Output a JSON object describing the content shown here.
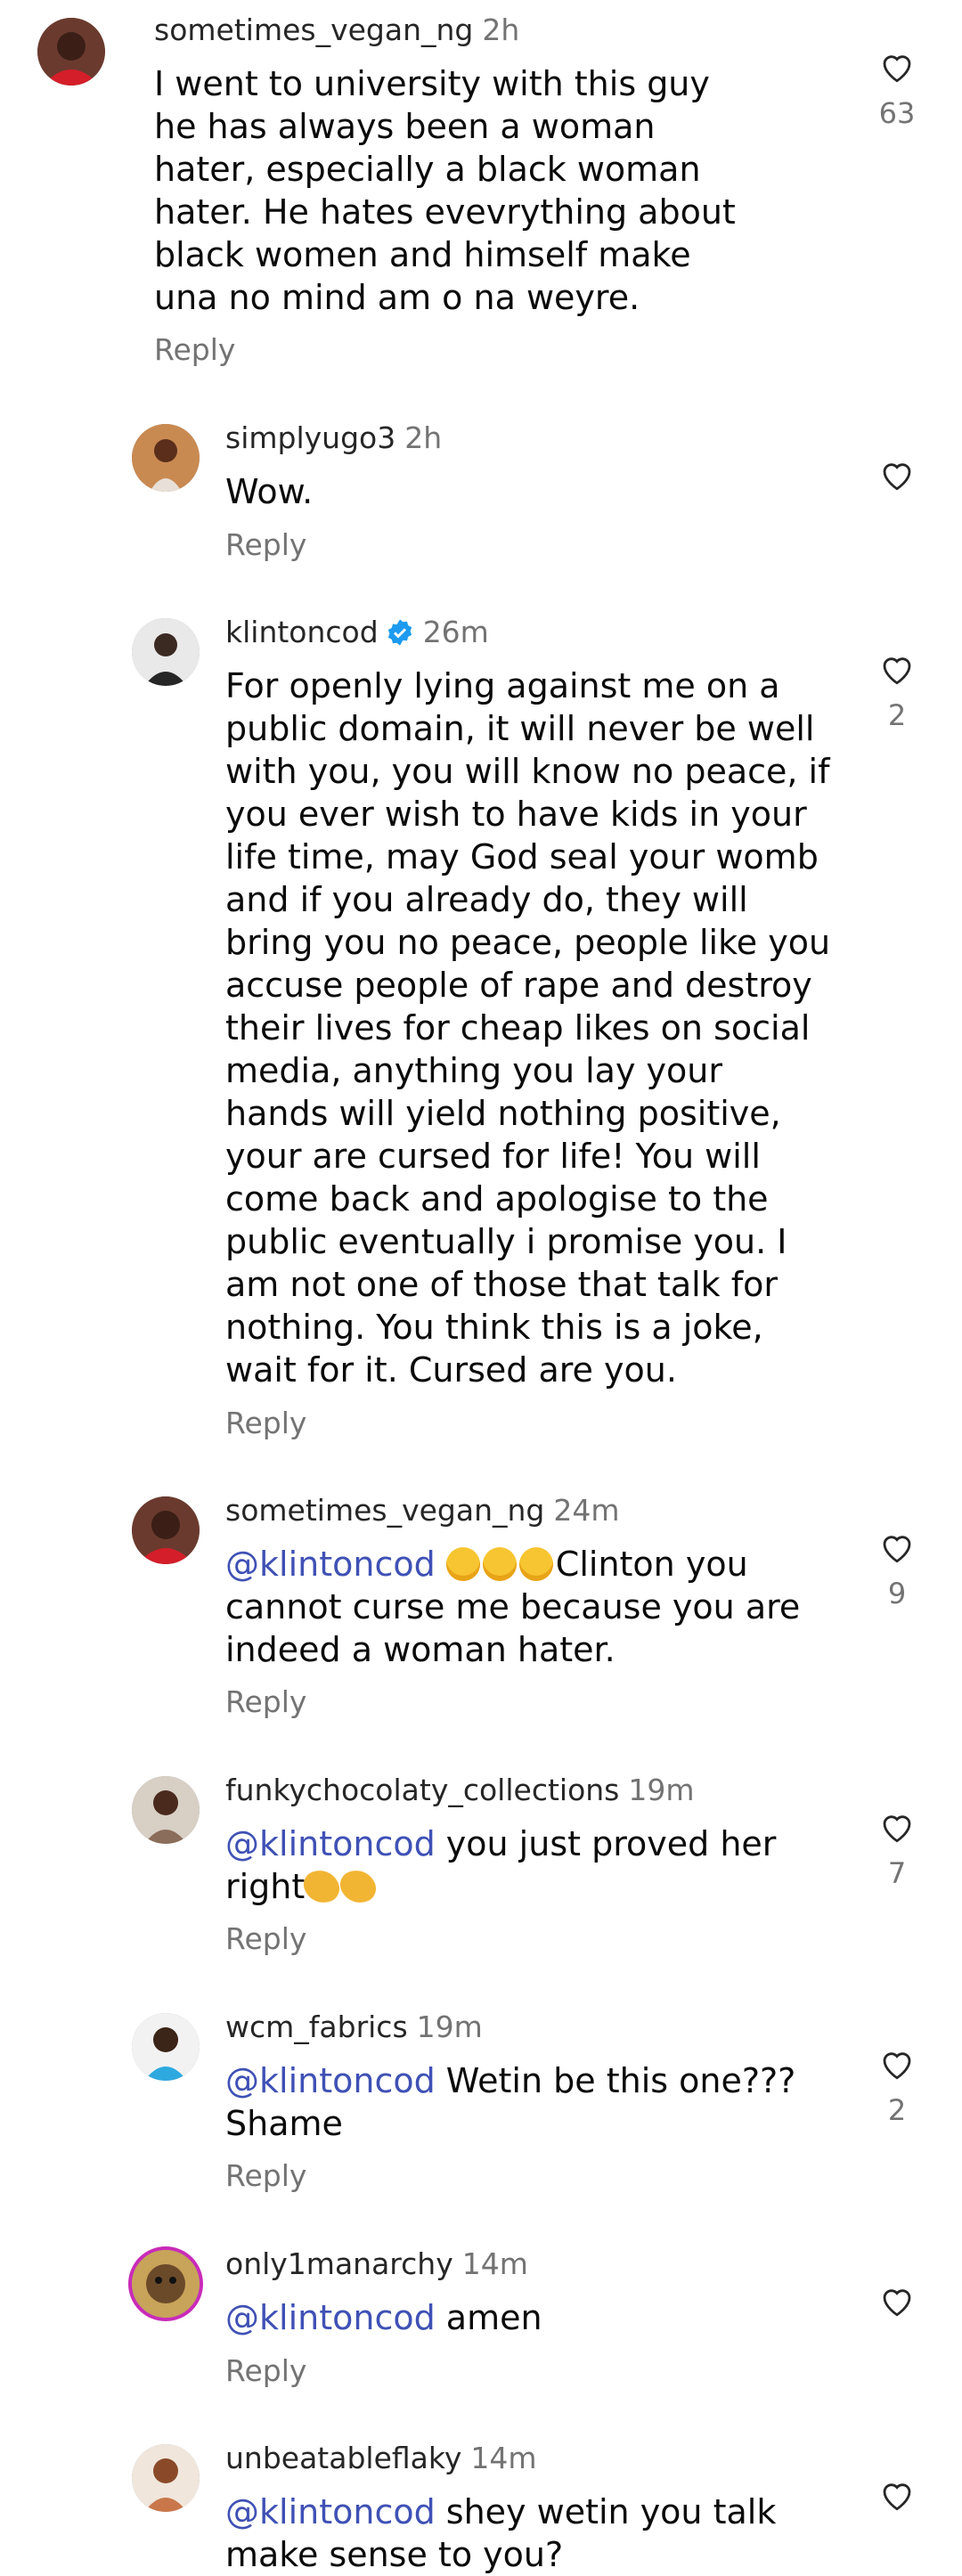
{
  "comments": [
    {
      "username": "sometimes_vegan_ng",
      "time": "2h",
      "text": "I went to university with this guy he has always been a woman hater, especially a black woman hater. He hates evevrything about black women and himself make una no mind am o na weyre.",
      "reply": "Reply",
      "likes": "63"
    },
    {
      "username": "simplyugo3",
      "time": "2h",
      "text": "Wow.",
      "reply": "Reply",
      "likes": ""
    },
    {
      "username": "klintoncod",
      "time": "26m",
      "verified": true,
      "text": "For openly lying against me on a public domain, it will never be well with you, you will know no peace, if you ever wish to have kids in your life time, may God seal your womb and if you already do, they will bring you no peace, people like you accuse people of rape and destroy their lives for cheap likes on social media, anything you lay your hands will yield nothing positive, your are cursed for life! You will come back and apologise to the public eventually i promise you. I am not one of those that talk for nothing. You think this is a joke, wait for it. Cursed are you.",
      "reply": "Reply",
      "likes": "2"
    },
    {
      "username": "sometimes_vegan_ng",
      "time": "24m",
      "mention": "@klintoncod",
      "text": "Clinton you cannot curse me because you are indeed a woman hater.",
      "reply": "Reply",
      "likes": "9"
    },
    {
      "username": "funkychocolaty_collections",
      "time": "19m",
      "mention": "@klintoncod",
      "text": " you just proved her right",
      "reply": "Reply",
      "likes": "7"
    },
    {
      "username": "wcm_fabrics",
      "time": "19m",
      "mention": "@klintoncod",
      "text": " Wetin be this one??? Shame",
      "reply": "Reply",
      "likes": "2"
    },
    {
      "username": "only1manarchy",
      "time": "14m",
      "mention": "@klintoncod",
      "text": " amen",
      "reply": "Reply",
      "likes": ""
    },
    {
      "username": "unbeatableflaky",
      "time": "14m",
      "mention": "@klintoncod",
      "text": " shey wetin you talk make sense to you?",
      "reply": "",
      "likes": ""
    }
  ],
  "colors": {
    "mention": "#3f51b5",
    "secondary": "#737373",
    "username": "#262626"
  },
  "icons": {
    "like": "heart-outline-icon",
    "verified": "verified-badge-icon"
  }
}
